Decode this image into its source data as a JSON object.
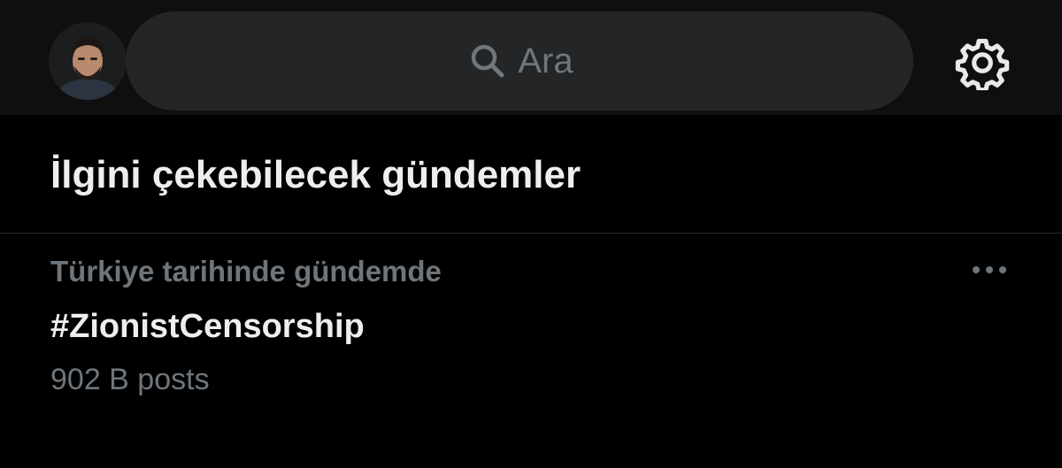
{
  "header": {
    "avatar_icon": "user-profile-photo",
    "search": {
      "icon": "search-icon",
      "placeholder": "Ara"
    },
    "settings_icon": "gear-icon"
  },
  "section": {
    "title": "İlgini çekebilecek gündemler"
  },
  "trends": [
    {
      "context": "Türkiye tarihinde gündemde",
      "name": "#ZionistCensorship",
      "count": "902 B posts",
      "more_icon": "more-horizontal-icon"
    }
  ],
  "colors": {
    "background": "#000000",
    "header_background": "#0f0f10",
    "search_background": "#232527",
    "primary_text": "#eceeef",
    "secondary_text": "#6e757b",
    "divider": "#2a2d30"
  }
}
